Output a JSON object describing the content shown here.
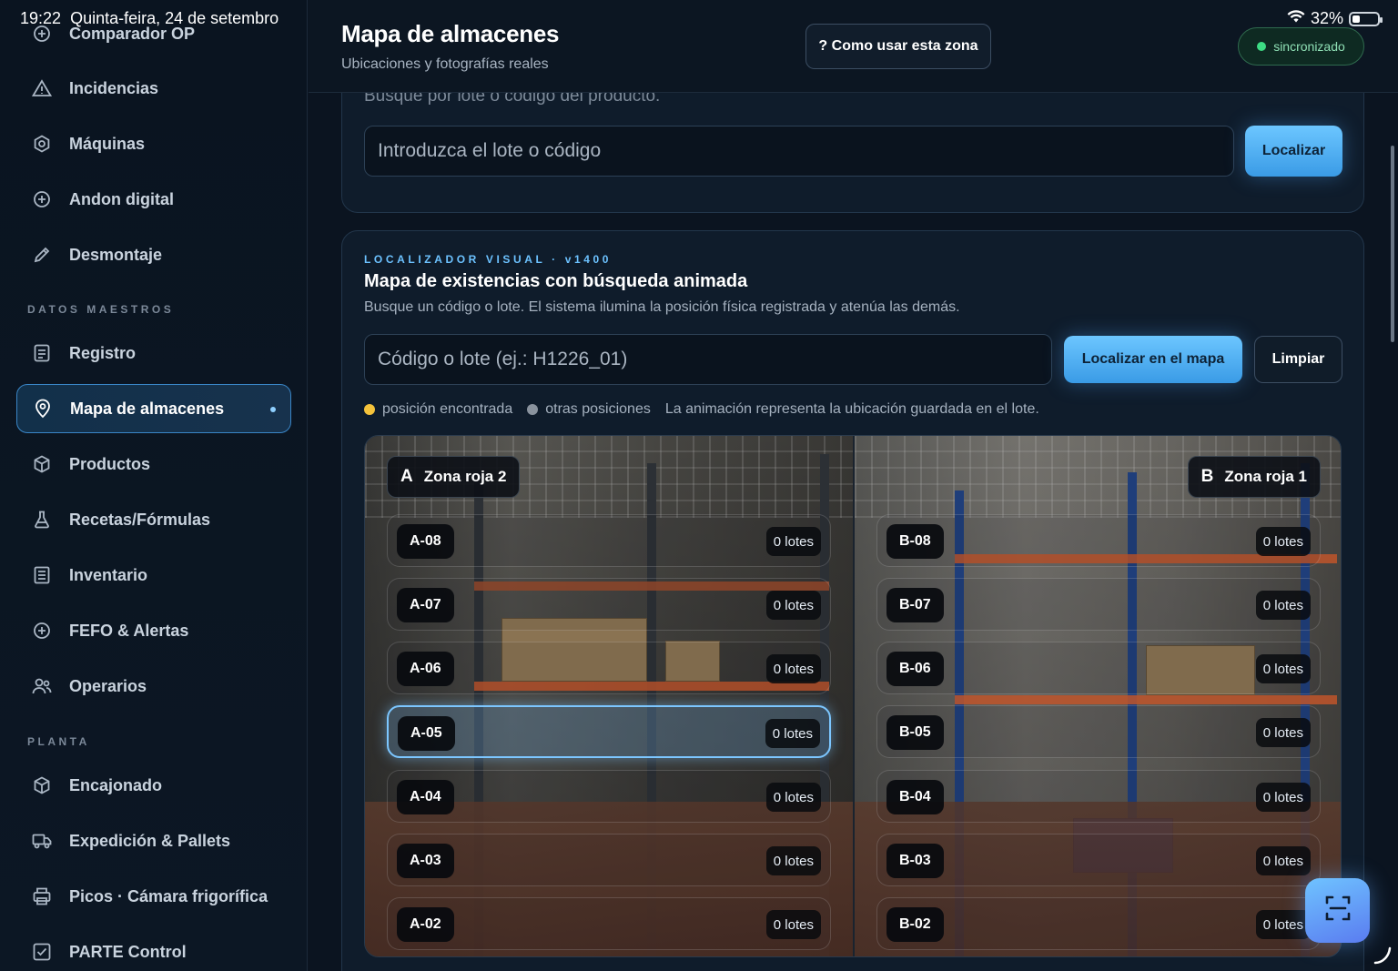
{
  "status": {
    "time": "19:22",
    "date": "Quinta-feira, 24 de setembro",
    "battery": "32%"
  },
  "sidebar": {
    "items": [
      {
        "label": "Comparador OP",
        "icon": "plus-circle-icon"
      },
      {
        "label": "Incidencias",
        "icon": "warning-triangle-icon"
      },
      {
        "label": "Máquinas",
        "icon": "gear-icon"
      },
      {
        "label": "Andon digital",
        "icon": "plus-circle-icon"
      },
      {
        "label": "Desmontaje",
        "icon": "pencil-icon"
      }
    ],
    "section_master": "DATOS MAESTROS",
    "master_items": [
      {
        "label": "Registro",
        "icon": "document-icon"
      },
      {
        "label": "Mapa de almacenes",
        "icon": "map-pin-icon",
        "active": true
      },
      {
        "label": "Productos",
        "icon": "box-icon"
      },
      {
        "label": "Recetas/Fórmulas",
        "icon": "flask-icon"
      },
      {
        "label": "Inventario",
        "icon": "list-document-icon"
      },
      {
        "label": "FEFO & Alertas",
        "icon": "plus-circle-icon"
      },
      {
        "label": "Operarios",
        "icon": "users-icon"
      }
    ],
    "section_plant": "PLANTA",
    "plant_items": [
      {
        "label": "Encajonado",
        "icon": "box-icon"
      },
      {
        "label": "Expedición & Pallets",
        "icon": "truck-icon"
      },
      {
        "label": "Picos · Cámara frigorífica",
        "icon": "printer-icon"
      },
      {
        "label": "PARTE Control",
        "icon": "checkbox-icon"
      }
    ]
  },
  "header": {
    "title": "Mapa de almacenes",
    "subtitle": "Ubicaciones y fotografías reales",
    "help_button": "? Como usar esta zona",
    "sync_status": "sincronizado"
  },
  "search_panel": {
    "hint": "Busque por lote o código del producto.",
    "input_placeholder": "Introduzca el lote o código",
    "button": "Localizar"
  },
  "locator_panel": {
    "eyebrow": "LOCALIZADOR VISUAL · v1400",
    "title": "Mapa de existencias con búsqueda animada",
    "description": "Busque un código o lote. El sistema ilumina la posición física registrada y atenúa las demás.",
    "input_placeholder": "Código o lote (ej.: H1226_01)",
    "locate_button": "Localizar en el mapa",
    "clear_button": "Limpiar",
    "legend": {
      "found": "posición encontrada",
      "others": "otras posiciones",
      "note": "La animación representa la ubicación guardada en el lote."
    },
    "colors": {
      "found": "#f5c33b",
      "others": "#8a939e",
      "accent": "#6cc6ff"
    }
  },
  "map": {
    "zone_a": {
      "letter": "A",
      "name": "Zona roja 2",
      "slots": [
        {
          "code": "A-08",
          "count": "0 lotes"
        },
        {
          "code": "A-07",
          "count": "0 lotes"
        },
        {
          "code": "A-06",
          "count": "0 lotes"
        },
        {
          "code": "A-05",
          "count": "0 lotes",
          "highlighted": true
        },
        {
          "code": "A-04",
          "count": "0 lotes"
        },
        {
          "code": "A-03",
          "count": "0 lotes"
        },
        {
          "code": "A-02",
          "count": "0 lotes"
        }
      ]
    },
    "zone_b": {
      "letter": "B",
      "name": "Zona roja 1",
      "slots": [
        {
          "code": "B-08",
          "count": "0 lotes"
        },
        {
          "code": "B-07",
          "count": "0 lotes"
        },
        {
          "code": "B-06",
          "count": "0 lotes"
        },
        {
          "code": "B-05",
          "count": "0 lotes"
        },
        {
          "code": "B-04",
          "count": "0 lotes"
        },
        {
          "code": "B-03",
          "count": "0 lotes"
        },
        {
          "code": "B-02",
          "count": "0 lotes"
        }
      ]
    }
  },
  "fab": {
    "icon": "scan-icon"
  }
}
